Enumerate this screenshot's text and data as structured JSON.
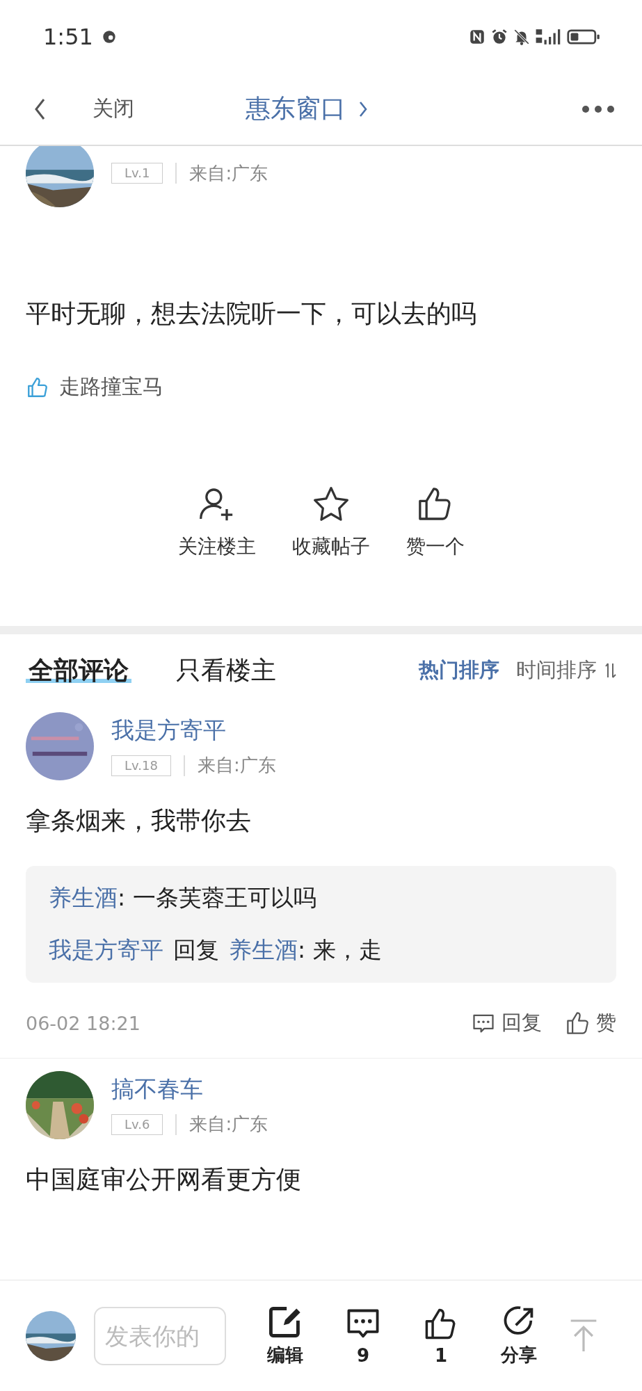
{
  "status_bar": {
    "time": "1:51"
  },
  "header": {
    "back_label": "关闭",
    "title": "惠东窗口"
  },
  "post": {
    "author": {
      "level": "Lv.1",
      "location": "来自:广东"
    },
    "text": "平时无聊，想去法院听一下，可以去的吗",
    "liked_by": "走路撞宝马"
  },
  "actions": [
    {
      "kind": "follow",
      "label": "关注楼主"
    },
    {
      "kind": "favorite",
      "label": "收藏帖子"
    },
    {
      "kind": "like",
      "label": "赞一个"
    }
  ],
  "comment_tabs": [
    {
      "label": "全部评论",
      "selected": true
    },
    {
      "label": "只看楼主",
      "selected": false
    }
  ],
  "sort_options": [
    {
      "label": "热门排序",
      "selected": true
    },
    {
      "label": "时间排序",
      "selected": false
    }
  ],
  "comments": [
    {
      "name": "我是方寄平",
      "level": "Lv.18",
      "location": "来自:广东",
      "text": "拿条烟来，我带你去",
      "replies": [
        {
          "author": "养生酒",
          "text": ": 一条芙蓉王可以吗"
        },
        {
          "author": "我是方寄平",
          "verb": "回复",
          "target": "养生酒",
          "text": ": 来，走"
        }
      ],
      "time": "06-02 18:21",
      "reply_label": "回复",
      "like_label": "赞"
    },
    {
      "name": "搞不春车",
      "level": "Lv.6",
      "location": "来自:广东",
      "text": "中国庭审公开网看更方便"
    }
  ],
  "bottom_bar": {
    "placeholder": "发表你的",
    "items": [
      {
        "kind": "edit",
        "label": "编辑"
      },
      {
        "kind": "comment",
        "label": "9"
      },
      {
        "kind": "like",
        "label": "1"
      },
      {
        "kind": "share",
        "label": "分享"
      }
    ]
  }
}
